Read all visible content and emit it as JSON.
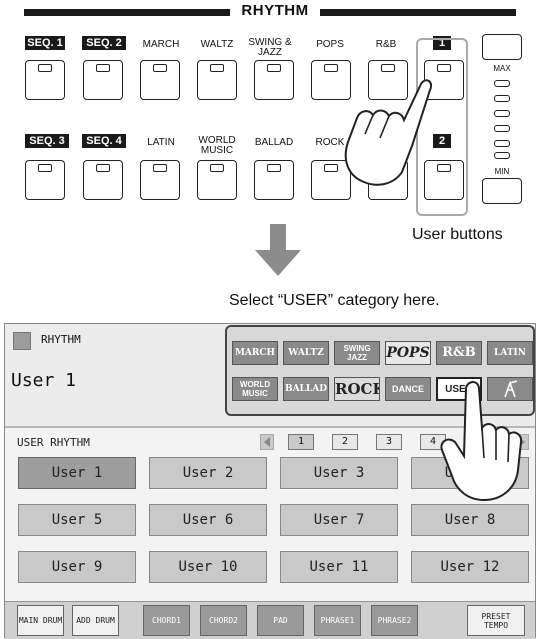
{
  "panel": {
    "title": "RHYTHM",
    "top_row": [
      "SEQ. 1",
      "SEQ. 2",
      "MARCH",
      "WALTZ",
      "SWING & JAZZ",
      "POPS",
      "R&B"
    ],
    "bottom_row": [
      "SEQ. 3",
      "SEQ. 4",
      "LATIN",
      "WORLD MUSIC",
      "BALLAD",
      "ROCK"
    ],
    "user_button_1": "1",
    "user_button_2": "2",
    "volume_max": "MAX",
    "volume_min": "MIN",
    "user_buttons_callout": "User buttons"
  },
  "instruction": "Select “USER” category here.",
  "lcd": {
    "header_label": "RHYTHM",
    "current_rhythm": "User 1",
    "categories": [
      "MARCH",
      "WALTZ",
      "SWING JAZZ",
      "POPS",
      "R&B",
      "LATIN",
      "WORLD MUSIC",
      "BALLAD",
      "ROCK",
      "DANCE",
      "USER"
    ],
    "section_title": "USER RHYTHM",
    "pages": [
      "1",
      "2",
      "3",
      "4"
    ],
    "user_rhythms": [
      "User 1",
      "User 2",
      "User 3",
      "User 4",
      "User 5",
      "User 6",
      "User 7",
      "User 8",
      "User 9",
      "User 10",
      "User 11",
      "User 12"
    ],
    "bottom_buttons": [
      "MAIN DRUM",
      "ADD DRUM",
      "CHORD1",
      "CHORD2",
      "PAD",
      "PHRASE1",
      "PHRASE2",
      "PRESET TEMPO"
    ]
  }
}
